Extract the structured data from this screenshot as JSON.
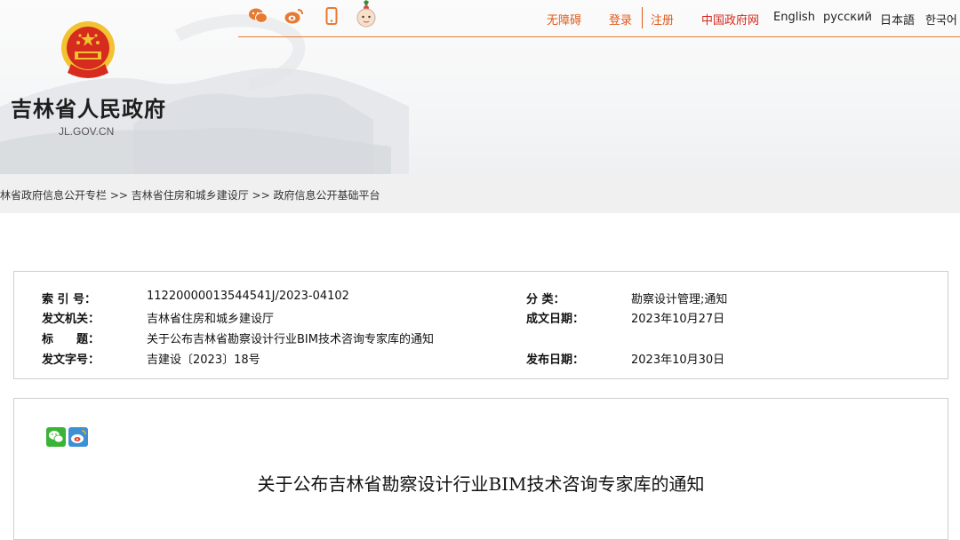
{
  "header": {
    "site_title": "吉林省人民政府",
    "site_domain": "JL.GOV.CN",
    "social_icons": [
      "wechat-icon",
      "weibo-icon",
      "mobile-icon",
      "mascot-icon"
    ],
    "nav": {
      "accessibility": "无障碍",
      "login": "登录",
      "register": "注册",
      "china_gov": "中国政府网",
      "english": "English",
      "russian": "русский",
      "japanese": "日本語",
      "korean": "한국어"
    },
    "accent_color": "#e05a1c"
  },
  "breadcrumb": {
    "text": "林省政府信息公开专栏 >> 吉林省住房和城乡建设厅 >> 政府信息公开基础平台"
  },
  "info": {
    "index_label": "索 引 号：",
    "index_value": "11220000013544541J/2023-04102",
    "category_label": "分 类：",
    "category_value": "勘察设计管理;通知",
    "issuer_label": "发文机关：",
    "issuer_value": "吉林省住房和城乡建设厅",
    "created_label": "成文日期：",
    "created_value": "2023年10月27日",
    "title_label": "标　　题：",
    "title_value": "关于公布吉林省勘察设计行业BIM技术咨询专家库的通知",
    "docno_label": "发文字号：",
    "docno_value": "吉建设〔2023〕18号",
    "published_label": "发布日期：",
    "published_value": "2023年10月30日"
  },
  "content": {
    "share_icons": [
      "wechat-share-icon",
      "weibo-share-icon"
    ],
    "doc_title": "关于公布吉林省勘察设计行业BIM技术咨询专家库的通知"
  }
}
